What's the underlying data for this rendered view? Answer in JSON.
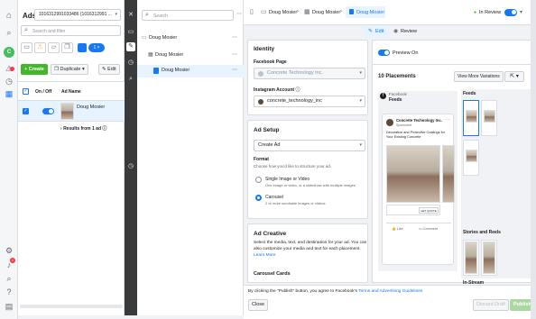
{
  "rail": {
    "items": [
      "home-icon",
      "search-icon",
      "account-avatar",
      "alert-icon",
      "history-icon",
      "grid-icon",
      "settings-icon",
      "notifications-icon",
      "search-bottom-icon",
      "help-icon",
      "report-icon"
    ],
    "avatar_letter": "C",
    "notif_count": "1"
  },
  "ads_panel": {
    "title": "Ads",
    "account_select": "1016312991033486 (1016312991 ...",
    "search_placeholder": "Search and filter",
    "create_label": "Create",
    "duplicate_label": "Duplicate",
    "edit_label": "Edit",
    "filter_count": "1",
    "col_onoff": "On / Off",
    "col_adname": "Ad Name",
    "row_name": "Doug Mosier",
    "results_label": "Results from 1 ad"
  },
  "tree": {
    "search_placeholder": "Search",
    "level1": "Doug Mosier",
    "level2": "Doug Mosier",
    "level3": "Doug Mosier"
  },
  "editor": {
    "breadcrumb": [
      "Doug Mosier",
      "Doug Mosier",
      "Doug Mosier"
    ],
    "status": "In Review",
    "tab_edit": "Edit",
    "tab_review": "Review",
    "identity": {
      "title": "Identity",
      "fb_page_label": "Facebook Page",
      "fb_page_value": "Concrete Technology Inc.",
      "ig_label": "Instagram Account",
      "ig_value": "concrete_technology_inc"
    },
    "ad_setup": {
      "title": "Ad Setup",
      "select_value": "Create Ad",
      "format_label": "Format",
      "format_help": "Choose how you'd like to structure your ad.",
      "opt1_title": "Single Image or Video",
      "opt1_desc": "One image or video, or a slideshow with multiple images",
      "opt2_title": "Carousel",
      "opt2_desc": "2 or more scrollable images or videos"
    },
    "creative": {
      "title": "Ad Creative",
      "desc1": "Select the media, text, and destination for your ad. You can",
      "desc2": "also customize your media and text for each placement.",
      "learn_more": "Learn More",
      "carousel_cards": "Carousel Cards"
    },
    "preview": {
      "toggle_label": "Preview On",
      "placements": "10 Placements",
      "more_variations": "View More Variations",
      "feed_title": "Facebook",
      "feed_sub": "Feeds",
      "page_name": "Concrete Technology Inc.",
      "sponsored": "Sponsored",
      "post_text": "Decorative and Protective Coatings for Your Existing Concrete",
      "cta": "GET QUOTE",
      "like": "Like",
      "comment": "Comment",
      "col_feeds": "Feeds",
      "col_stories": "Stories and Reels",
      "col_instream": "In-Stream"
    },
    "footer": {
      "notice_prefix": "By clicking the \"Publish\" button, you agree to Facebook's",
      "notice_link": "Terms and Advertising Guidelines",
      "close": "Close",
      "discard": "Discard Draft",
      "publish": "Publish"
    }
  },
  "colors": {
    "accent": "#1877f2",
    "green": "#42b72a",
    "dark": "#3a3b3c"
  }
}
